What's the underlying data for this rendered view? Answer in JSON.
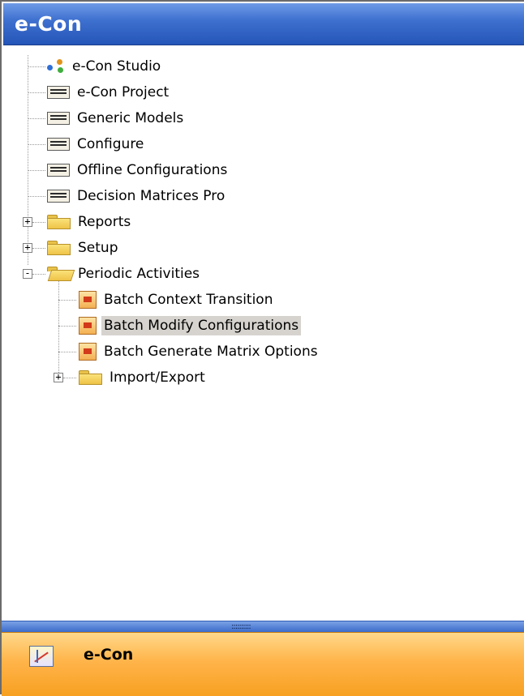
{
  "window": {
    "title": "e-Con"
  },
  "tree": {
    "items": [
      {
        "label": "e-Con Studio",
        "icon": "studio-icon"
      },
      {
        "label": "e-Con Project",
        "icon": "form-icon"
      },
      {
        "label": "Generic Models",
        "icon": "form-icon"
      },
      {
        "label": "Configure",
        "icon": "form-icon"
      },
      {
        "label": "Offline Configurations",
        "icon": "form-icon"
      },
      {
        "label": "Decision Matrices Pro",
        "icon": "form-icon"
      },
      {
        "label": "Reports",
        "icon": "folder-icon",
        "expander": "+"
      },
      {
        "label": "Setup",
        "icon": "folder-icon",
        "expander": "+"
      },
      {
        "label": "Periodic Activities",
        "icon": "open-folder-icon",
        "expander": "-"
      },
      {
        "label": "Batch Context Transition",
        "icon": "report-icon"
      },
      {
        "label": "Batch Modify Configurations",
        "icon": "report-icon",
        "selected": true
      },
      {
        "label": "Batch Generate Matrix Options",
        "icon": "report-icon"
      },
      {
        "label": "Import/Export",
        "icon": "folder-icon",
        "expander": "+"
      }
    ]
  },
  "splitter": {
    "grip": "::::::::::"
  },
  "navbar": {
    "label": "e-Con",
    "icon": "e-con-app-icon"
  },
  "colors": {
    "title_bar": "#3f71d0",
    "nav_bar": "#ffb44a",
    "selection": "#d6d3ce"
  }
}
